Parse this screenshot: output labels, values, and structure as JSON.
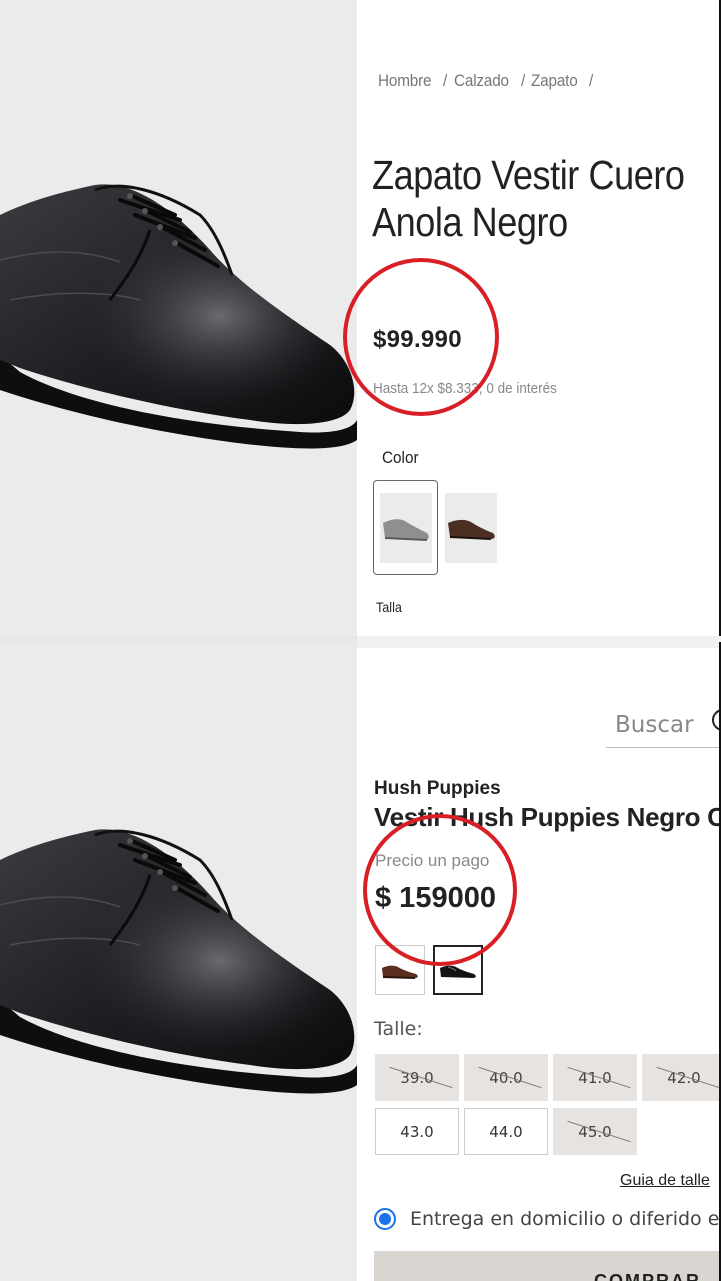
{
  "top": {
    "breadcrumb": [
      "Hombre",
      "Calzado",
      "Zapato"
    ],
    "breadcrumb_separator": "/",
    "title_line1": "Zapato Vestir Cuero",
    "title_line2": "Anola Negro",
    "price": "$99.990",
    "installments": "Hasta 12x $8.333, 0 de interés",
    "color_label": "Color",
    "size_label": "Talla",
    "swatches": [
      {
        "shoe_color": "#8f8f8f",
        "selected": true
      },
      {
        "shoe_color": "#4a2f22",
        "selected": false
      }
    ]
  },
  "bottom": {
    "search_placeholder": "Buscar",
    "brand": "Hush Puppies",
    "title": "Vestir Hush Puppies Negro C",
    "price_caption": "Precio un pago",
    "price": "$ 159000",
    "size_label": "Talle:",
    "sizes": [
      {
        "label": "39.0",
        "available": false
      },
      {
        "label": "40.0",
        "available": false
      },
      {
        "label": "41.0",
        "available": false
      },
      {
        "label": "42.0",
        "available": false
      },
      {
        "label": "43.0",
        "available": true
      },
      {
        "label": "44.0",
        "available": true
      },
      {
        "label": "45.0",
        "available": false
      }
    ],
    "size_guide": "Guia de talle",
    "delivery_option": "Entrega en domicilio o diferido en",
    "buy_button": "COMPRAR",
    "swatches": [
      {
        "shoe_color": "#5a2e20",
        "selected": false
      },
      {
        "shoe_color": "#141414",
        "selected": true
      }
    ]
  },
  "colors": {
    "annotation_red": "#d81f26",
    "radio_blue": "#1a73e8",
    "unavailable_bg": "#e6e3e0",
    "image_bg": "#ebebeb"
  },
  "icons": [
    "search-icon"
  ]
}
